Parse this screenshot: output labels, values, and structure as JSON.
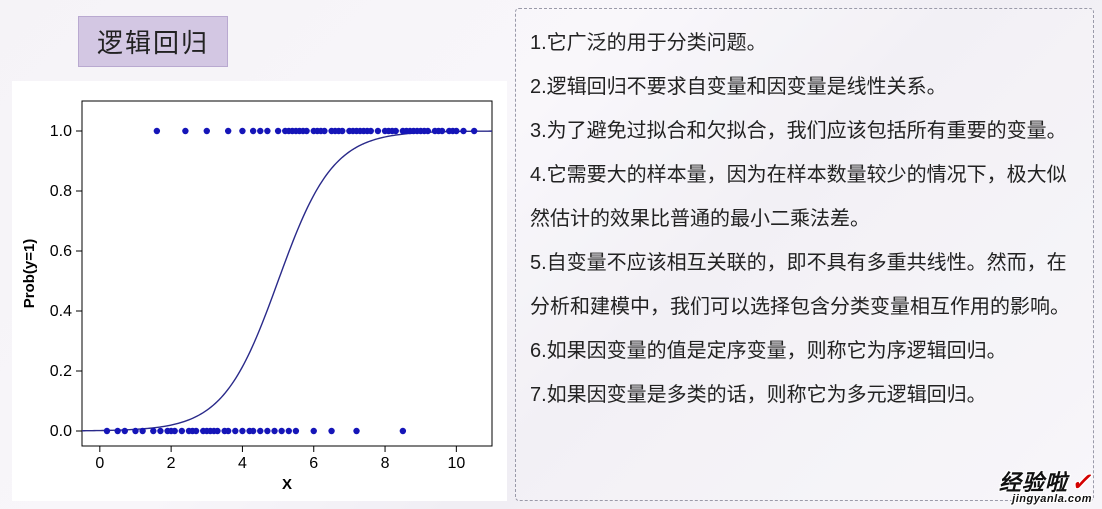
{
  "title": "逻辑回归",
  "bullets": [
    "1.它广泛的用于分类问题。",
    "2.逻辑回归不要求自变量和因变量是线性关系。",
    "3.为了避免过拟合和欠拟合，我们应该包括所有重要的变量。",
    "4.它需要大的样本量，因为在样本数量较少的情况下，极大似然估计的效果比普通的最小二乘法差。",
    "5.自变量不应该相互关联的，即不具有多重共线性。然而，在分析和建模中，我们可以选择包含分类变量相互作用的影响。",
    "6.如果因变量的值是定序变量，则称它为序逻辑回归。",
    "7.如果因变量是多类的话，则称它为多元逻辑回归。"
  ],
  "watermark": {
    "cn": "经验啦",
    "check": "✓",
    "en": "jingyanla.com"
  },
  "chart_data": {
    "type": "scatter",
    "title": "",
    "xlabel": "X",
    "ylabel": "Prob(y=1)",
    "xlim": [
      -0.5,
      11
    ],
    "ylim": [
      -0.05,
      1.1
    ],
    "xticks": [
      0,
      2,
      4,
      6,
      8,
      10
    ],
    "yticks": [
      0.0,
      0.2,
      0.4,
      0.6,
      0.8,
      1.0
    ],
    "curve": {
      "name": "logistic",
      "k": 1.3,
      "x0": 5.0
    },
    "series": [
      {
        "name": "y=0",
        "y": 0.0,
        "x": [
          0.2,
          0.5,
          0.7,
          1.0,
          1.2,
          1.5,
          1.7,
          1.9,
          2.0,
          2.1,
          2.3,
          2.5,
          2.6,
          2.7,
          2.9,
          3.0,
          3.1,
          3.2,
          3.3,
          3.5,
          3.6,
          3.8,
          4.0,
          4.2,
          4.3,
          4.5,
          4.7,
          4.9,
          5.1,
          5.3,
          5.5,
          6.0,
          6.5,
          7.2,
          8.5
        ]
      },
      {
        "name": "y=1",
        "y": 1.0,
        "x": [
          1.6,
          2.4,
          3.0,
          3.6,
          4.0,
          4.3,
          4.5,
          4.7,
          5.0,
          5.2,
          5.3,
          5.4,
          5.5,
          5.6,
          5.7,
          5.8,
          6.0,
          6.1,
          6.2,
          6.3,
          6.5,
          6.6,
          6.7,
          6.8,
          7.0,
          7.1,
          7.2,
          7.3,
          7.4,
          7.5,
          7.6,
          7.8,
          8.0,
          8.1,
          8.2,
          8.3,
          8.5,
          8.6,
          8.7,
          8.8,
          8.9,
          9.0,
          9.1,
          9.2,
          9.4,
          9.5,
          9.6,
          9.8,
          9.9,
          10.0,
          10.2,
          10.5
        ]
      }
    ]
  }
}
